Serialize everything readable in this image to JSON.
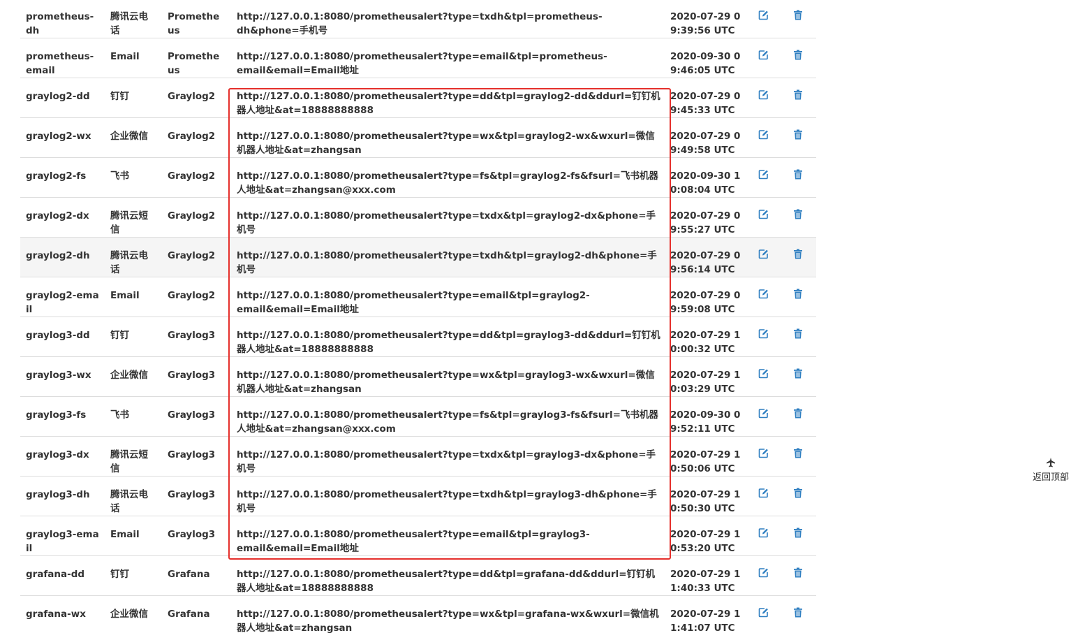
{
  "colors": {
    "accent_blue": "#2f7fc1",
    "highlight_red": "#e5302c",
    "border": "#dddddd",
    "hover_row": "#f5f5f5"
  },
  "rows": [
    {
      "name": "prometheus-dh",
      "channel": "腾讯云电话",
      "source": "Prometheus",
      "url": "http://127.0.0.1:8080/prometheusalert?type=txdh&tpl=prometheus-dh&phone=手机号",
      "time": "2020-07-29 09:39:56 UTC"
    },
    {
      "name": "prometheus-email",
      "channel": "Email",
      "source": "Prometheus",
      "url": "http://127.0.0.1:8080/prometheusalert?type=email&tpl=prometheus-email&email=Email地址",
      "time": "2020-09-30 09:46:05 UTC"
    },
    {
      "name": "graylog2-dd",
      "channel": "钉钉",
      "source": "Graylog2",
      "url": "http://127.0.0.1:8080/prometheusalert?type=dd&tpl=graylog2-dd&ddurl=钉钉机器人地址&at=18888888888",
      "time": "2020-07-29 09:45:33 UTC"
    },
    {
      "name": "graylog2-wx",
      "channel": "企业微信",
      "source": "Graylog2",
      "url": "http://127.0.0.1:8080/prometheusalert?type=wx&tpl=graylog2-wx&wxurl=微信机器人地址&at=zhangsan",
      "time": "2020-07-29 09:49:58 UTC"
    },
    {
      "name": "graylog2-fs",
      "channel": "飞书",
      "source": "Graylog2",
      "url": "http://127.0.0.1:8080/prometheusalert?type=fs&tpl=graylog2-fs&fsurl=飞书机器人地址&at=zhangsan@xxx.com",
      "time": "2020-09-30 10:08:04 UTC"
    },
    {
      "name": "graylog2-dx",
      "channel": "腾讯云短信",
      "source": "Graylog2",
      "url": "http://127.0.0.1:8080/prometheusalert?type=txdx&tpl=graylog2-dx&phone=手机号",
      "time": "2020-07-29 09:55:27 UTC"
    },
    {
      "name": "graylog2-dh",
      "channel": "腾讯云电话",
      "source": "Graylog2",
      "url": "http://127.0.0.1:8080/prometheusalert?type=txdh&tpl=graylog2-dh&phone=手机号",
      "time": "2020-07-29 09:56:14 UTC"
    },
    {
      "name": "graylog2-email",
      "channel": "Email",
      "source": "Graylog2",
      "url": "http://127.0.0.1:8080/prometheusalert?type=email&tpl=graylog2-email&email=Email地址",
      "time": "2020-07-29 09:59:08 UTC"
    },
    {
      "name": "graylog3-dd",
      "channel": "钉钉",
      "source": "Graylog3",
      "url": "http://127.0.0.1:8080/prometheusalert?type=dd&tpl=graylog3-dd&ddurl=钉钉机器人地址&at=18888888888",
      "time": "2020-07-29 10:00:32 UTC"
    },
    {
      "name": "graylog3-wx",
      "channel": "企业微信",
      "source": "Graylog3",
      "url": "http://127.0.0.1:8080/prometheusalert?type=wx&tpl=graylog3-wx&wxurl=微信机器人地址&at=zhangsan",
      "time": "2020-07-29 10:03:29 UTC"
    },
    {
      "name": "graylog3-fs",
      "channel": "飞书",
      "source": "Graylog3",
      "url": "http://127.0.0.1:8080/prometheusalert?type=fs&tpl=graylog3-fs&fsurl=飞书机器人地址&at=zhangsan@xxx.com",
      "time": "2020-09-30 09:52:11 UTC"
    },
    {
      "name": "graylog3-dx",
      "channel": "腾讯云短信",
      "source": "Graylog3",
      "url": "http://127.0.0.1:8080/prometheusalert?type=txdx&tpl=graylog3-dx&phone=手机号",
      "time": "2020-07-29 10:50:06 UTC"
    },
    {
      "name": "graylog3-dh",
      "channel": "腾讯云电话",
      "source": "Graylog3",
      "url": "http://127.0.0.1:8080/prometheusalert?type=txdh&tpl=graylog3-dh&phone=手机号",
      "time": "2020-07-29 10:50:30 UTC"
    },
    {
      "name": "graylog3-email",
      "channel": "Email",
      "source": "Graylog3",
      "url": "http://127.0.0.1:8080/prometheusalert?type=email&tpl=graylog3-email&email=Email地址",
      "time": "2020-07-29 10:53:20 UTC"
    },
    {
      "name": "grafana-dd",
      "channel": "钉钉",
      "source": "Grafana",
      "url": "http://127.0.0.1:8080/prometheusalert?type=dd&tpl=grafana-dd&ddurl=钉钉机器人地址&at=18888888888",
      "time": "2020-07-29 11:40:33 UTC"
    },
    {
      "name": "grafana-wx",
      "channel": "企业微信",
      "source": "Grafana",
      "url": "http://127.0.0.1:8080/prometheusalert?type=wx&tpl=grafana-wx&wxurl=微信机器人地址&at=zhangsan",
      "time": "2020-07-29 11:41:07 UTC"
    }
  ],
  "icons": {
    "edit": "edit-icon",
    "delete": "trash-icon",
    "back_to_top": "airplane-icon"
  },
  "back_to_top": {
    "label": "返回顶部"
  }
}
